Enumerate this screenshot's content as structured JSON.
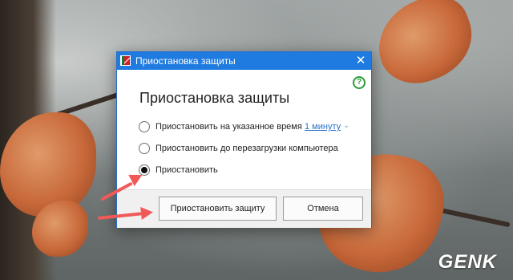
{
  "dialog": {
    "title": "Приостановка защиты",
    "close_glyph": "✕",
    "help_glyph": "?",
    "heading": "Приостановка защиты",
    "options": [
      {
        "label": "Приостановить на указанное время",
        "selected": false,
        "time_value": "1 минуту"
      },
      {
        "label": "Приостановить до перезагрузки компьютера",
        "selected": false
      },
      {
        "label": "Приостановить",
        "selected": true
      }
    ],
    "buttons": {
      "primary": "Приостановить защиту",
      "cancel": "Отмена"
    }
  },
  "icons": {
    "app": "kaspersky-logo-icon",
    "close": "close-icon",
    "help": "help-icon",
    "chevron": "chevron-down-icon"
  },
  "colors": {
    "titlebar": "#1f7be0",
    "link": "#2a72c8",
    "help": "#2e9b3a",
    "annotation_arrow": "#f05a57"
  },
  "watermark": "GENK"
}
